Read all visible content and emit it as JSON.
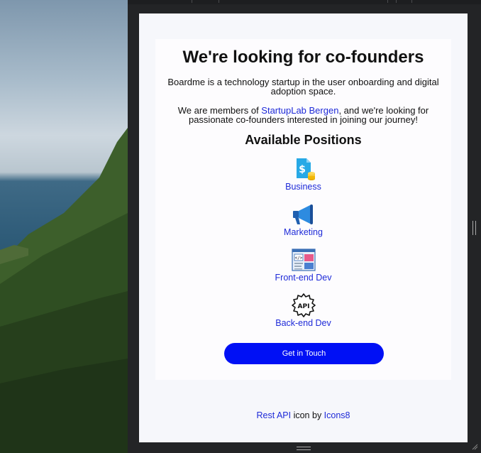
{
  "page": {
    "heading": "We're looking for co-founders",
    "intro": "Boardme is a technology startup in the user onboarding and digital adoption space.",
    "members_prefix": "We are members of ",
    "members_link": "StartupLab Bergen",
    "members_suffix": ", and we're looking for passionate co-founders interested in joining our journey!",
    "positions_heading": "Available Positions",
    "positions": [
      {
        "label": "Business",
        "icon": "dollar-document-icon"
      },
      {
        "label": "Marketing",
        "icon": "megaphone-icon"
      },
      {
        "label": "Front-end Dev",
        "icon": "code-window-icon"
      },
      {
        "label": "Back-end Dev",
        "icon": "api-gear-icon"
      }
    ],
    "cta_label": "Get in Touch",
    "credit_link1": "Rest API",
    "credit_mid": " icon by ",
    "credit_link2": "Icons8"
  },
  "colors": {
    "link": "#1e2ad8",
    "button": "#0010f5",
    "frame": "#232426"
  }
}
